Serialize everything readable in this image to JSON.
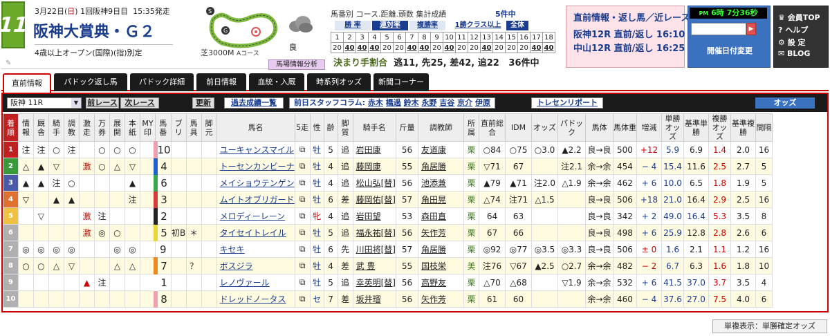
{
  "race": {
    "number": "11",
    "date": "3月22日",
    "dow": "日",
    "meeting": "1回阪神9日目",
    "start_time": "15:35発走",
    "title": "阪神大賞典・Ｇ２",
    "conditions": "4歳以上オープン(国際)(指)別定",
    "course": "芝3000M",
    "course_sub": "Aコース",
    "weather": "良",
    "weather_icon": "cloud-icon"
  },
  "paddock_button": "馬場情報分析",
  "stats": {
    "title": "馬番別 コース.距離.頭数 集計成績",
    "count": "5件中",
    "tabs": [
      "勝 率",
      "連対率",
      "複勝率"
    ],
    "class_tab": "1勝クラス以上",
    "all_tab": "全体",
    "row1": [
      "1",
      "2",
      "3",
      "4",
      "5",
      "6",
      "7",
      "8",
      "9",
      "10",
      "11",
      "12",
      "13",
      "14",
      "15",
      "16",
      "17",
      "18"
    ],
    "row2": [
      "20",
      "40",
      "40",
      "40",
      "20",
      "20",
      "40",
      "40",
      "20",
      "40",
      "20",
      "20",
      "40",
      "20",
      "20",
      "20",
      "40",
      "40"
    ],
    "kimarite_label": "決まり手割合",
    "kimarite": "逃11, 先25, 差42, 追22",
    "kimarite_count": "36件中"
  },
  "news": {
    "title": "直前情報・返し馬／近レース",
    "line1": "阪神12R 直前/返し 16:10",
    "line2": "中山12R 直前/返し 16:25"
  },
  "clock": {
    "ampm": "PM",
    "time": "6時 7分36秒",
    "date_change": "開催日付変更"
  },
  "menu": [
    "会員TOP",
    "ヘルプ",
    "設 定",
    "BLOG"
  ],
  "tabs": [
    "直前情報",
    "パドック返し馬",
    "パドック詳細",
    "前日情報",
    "血統・入厩",
    "時系列オッズ",
    "新聞コーナー"
  ],
  "toolbar": {
    "race_select": "阪神 11R",
    "prev": "前レース",
    "next": "次レース",
    "update": "更新",
    "past": "過去成績一覧",
    "staff_label": "前日スタッフコラム:",
    "staff": [
      "赤木",
      "橋過",
      "鈴木",
      "永野",
      "吉谷",
      "京介",
      "伊原"
    ],
    "trecen": "トレセンリポート",
    "odds": "オッズ"
  },
  "headers": [
    "着順",
    "情報",
    "厩舎",
    "騎手",
    "調教",
    "激走",
    "万券",
    "展開",
    "本紙",
    "MY印",
    "馬番",
    "ブリ",
    "馬具",
    "脚元",
    "馬名",
    "5走",
    "性",
    "齢",
    "脚質",
    "騎手名",
    "斤量",
    "調教師",
    "所属",
    "直前総合",
    "IDM",
    "オッズ",
    "パドック",
    "馬体",
    "馬体重",
    "増減",
    "単勝オッズ",
    "基準単勝",
    "複勝オッズ",
    "基準複勝",
    "間隔"
  ],
  "rows": [
    {
      "n": "1",
      "c": [
        "注",
        "注",
        "○",
        "注",
        "",
        "○",
        "○",
        "○",
        ""
      ],
      "ban": "10",
      "bl": "",
      "gu": "",
      "name": "ユーキャンスマイル",
      "sex": "牡",
      "age": "5",
      "kyaku": "追",
      "jockey": "岩田康",
      "kin": "56",
      "trainer": "友道康",
      "sho": "栗",
      "total": "○84",
      "idm": "○75",
      "odds": "○3.0",
      "pad": "▲2.2",
      "tai": "良→良",
      "wt": "500",
      "zg": "+12",
      "tan": "5.9",
      "ktan": "6.9",
      "fuku": "1.4",
      "kfuku": "2.0",
      "kan": "16"
    },
    {
      "n": "2",
      "c": [
        "△",
        "▲",
        "▽",
        "",
        "激",
        "○",
        "△",
        "▽",
        ""
      ],
      "ban": "4",
      "bl": "",
      "gu": "",
      "name": "トーセンカンビーナ",
      "sex": "牡",
      "age": "4",
      "kyaku": "追",
      "jockey": "藤岡康",
      "kin": "55",
      "trainer": "角居勝",
      "sho": "栗",
      "total": "▽71",
      "idm": "67",
      "odds": "",
      "pad": "注2.1",
      "tai": "余→余",
      "wt": "454",
      "zg": "− 4",
      "tan": "15.4",
      "ktan": "11.6",
      "fuku": "2.5",
      "kfuku": "2.7",
      "kan": "5"
    },
    {
      "n": "3",
      "c": [
        "▲",
        "▲",
        "注",
        "○",
        "",
        "",
        "",
        "▲",
        ""
      ],
      "ban": "6",
      "bl": "",
      "gu": "",
      "name": "メイショウテンゲン",
      "sex": "牡",
      "age": "4",
      "kyaku": "追",
      "jockey": "松山弘[替]",
      "kin": "56",
      "trainer": "池添兼",
      "sho": "栗",
      "total": "▲79",
      "idm": "▲71",
      "odds": "注2.0",
      "pad": "△1.9",
      "tai": "余→余",
      "wt": "462",
      "zg": "+ 6",
      "tan": "10.0",
      "ktan": "6.5",
      "fuku": "1.8",
      "kfuku": "1.9",
      "kan": "5"
    },
    {
      "n": "4",
      "c": [
        "▽",
        "",
        "▲",
        "▲",
        "",
        "",
        "",
        "注",
        ""
      ],
      "ban": "3",
      "bl": "",
      "gu": "",
      "name": "ムイトオブリガード",
      "sex": "牡",
      "age": "6",
      "kyaku": "差",
      "jockey": "藤岡佑[替]",
      "kin": "57",
      "trainer": "角田晃",
      "sho": "栗",
      "total": "△74",
      "idm": "注71",
      "odds": "△1.5",
      "pad": "",
      "tai": "良→良",
      "wt": "506",
      "zg": "+18",
      "tan": "21.0",
      "ktan": "16.4",
      "fuku": "2.9",
      "kfuku": "2.5",
      "kan": "16"
    },
    {
      "n": "5",
      "c": [
        "",
        "▽",
        "",
        "",
        "激",
        "注",
        "",
        "",
        ""
      ],
      "ban": "2",
      "bl": "",
      "gu": "",
      "name": "メロディーレーン",
      "sex": "牝",
      "age": "4",
      "kyaku": "追",
      "jockey": "岩田望",
      "kin": "53",
      "trainer": "森田直",
      "sho": "栗",
      "total": "64",
      "idm": "63",
      "odds": "",
      "pad": "",
      "tai": "良→良",
      "wt": "342",
      "zg": "+ 2",
      "tan": "49.0",
      "ktan": "16.4",
      "fuku": "5.3",
      "kfuku": "3.5",
      "kan": "8"
    },
    {
      "n": "6",
      "c": [
        "",
        "",
        "",
        "",
        "激",
        "◎",
        "○",
        "",
        ""
      ],
      "ban": "5",
      "bl": "初B",
      "gu": "＊",
      "name": "タイセイトレイル",
      "sex": "牡",
      "age": "5",
      "kyaku": "追",
      "jockey": "福永祐[替]",
      "kin": "56",
      "trainer": "矢作芳",
      "sho": "栗",
      "total": "67",
      "idm": "66",
      "odds": "",
      "pad": "",
      "tai": "良→良",
      "wt": "498",
      "zg": "+ 6",
      "tan": "25.9",
      "ktan": "12.8",
      "fuku": "2.8",
      "kfuku": "2.6",
      "kan": "6"
    },
    {
      "n": "7",
      "c": [
        "◎",
        "◎",
        "◎",
        "◎",
        "",
        "",
        "◎",
        "◎",
        ""
      ],
      "ban": "9",
      "bl": "",
      "gu": "",
      "name": "キセキ",
      "sex": "牡",
      "age": "6",
      "kyaku": "先",
      "jockey": "川田将[替]",
      "kin": "57",
      "trainer": "角居勝",
      "sho": "栗",
      "total": "◎92",
      "idm": "◎77",
      "odds": "◎3.5",
      "pad": "◎3.3",
      "tai": "良→良",
      "wt": "506",
      "zg": "± 0",
      "tan": "1.6",
      "ktan": "2.1",
      "fuku": "1.1",
      "kfuku": "1.2",
      "kan": "16"
    },
    {
      "n": "8",
      "c": [
        "○",
        "○",
        "△",
        "▽",
        "",
        "",
        "△",
        "△",
        ""
      ],
      "ban": "7",
      "bl": "",
      "gu": "？",
      "name": "ボスジラ",
      "sex": "牡",
      "age": "4",
      "kyaku": "差",
      "jockey": "武 豊",
      "kin": "55",
      "trainer": "国枝栄",
      "sho": "美",
      "total": "注76",
      "idm": "▽67",
      "odds": "▲2.5",
      "pad": "○2.7",
      "tai": "余→余",
      "wt": "482",
      "zg": "− 2",
      "tan": "6.7",
      "ktan": "6.3",
      "fuku": "1.6",
      "kfuku": "1.8",
      "kan": "10"
    },
    {
      "n": "9",
      "c": [
        "",
        "",
        "",
        "",
        "▲",
        "注",
        "",
        "",
        ""
      ],
      "ban": "1",
      "bl": "",
      "gu": "",
      "name": "レノヴァール",
      "sex": "牡",
      "age": "5",
      "kyaku": "追",
      "jockey": "幸英明[替]",
      "kin": "56",
      "trainer": "高野友",
      "sho": "栗",
      "total": "△70",
      "idm": "△68",
      "odds": "",
      "pad": "▽1.9",
      "tai": "余→余",
      "wt": "532",
      "zg": "+ 6",
      "tan": "41.5",
      "ktan": "37.0",
      "fuku": "3.7",
      "kfuku": "3.5",
      "kan": "4"
    },
    {
      "n": "10",
      "c": [
        "",
        "",
        "",
        "",
        "",
        "",
        "",
        "",
        ""
      ],
      "ban": "8",
      "bl": "",
      "gu": "",
      "name": "ドレッドノータス",
      "sex": "セ",
      "age": "7",
      "kyaku": "差",
      "jockey": "坂井瑠",
      "kin": "56",
      "trainer": "矢作芳",
      "sho": "栗",
      "total": "61",
      "idm": "60",
      "odds": "",
      "pad": "",
      "tai": "余→余",
      "wt": "460",
      "zg": "− 4",
      "tan": "37.6",
      "ktan": "27.0",
      "fuku": "7.5",
      "kfuku": "4.0",
      "kan": "6"
    }
  ],
  "colors": {
    "waku": [
      "#ffffff",
      "#222222",
      "#d93a3a",
      "#1f5fcf",
      "#e8d63a",
      "#3aa84a",
      "#f08a20",
      "#f0a0b0"
    ],
    "rank": [
      "#c02020",
      "#3a9a3a",
      "#4a5aa8",
      "#e07030",
      "#f0c040",
      "#b0b0b0",
      "#b0b0b0",
      "#b0b0b0",
      "#b0b0b0",
      "#b0b0b0"
    ]
  },
  "footer": "単複表示：単勝確定オッズ"
}
